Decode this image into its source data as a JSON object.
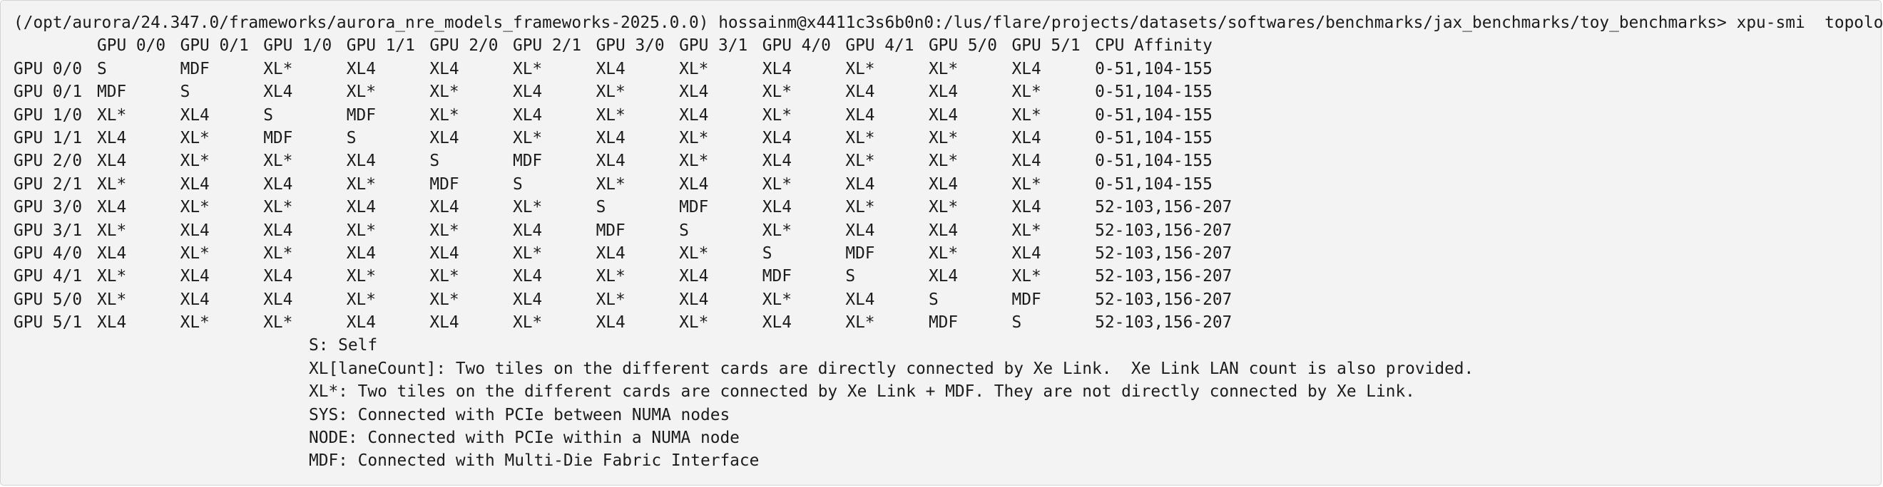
{
  "terminal": {
    "prompt": "(/opt/aurora/24.347.0/frameworks/aurora_nre_models_frameworks-2025.0.0) hossainm@x4411c3s6b0n0:/lus/flare/projects/datasets/softwares/benchmarks/jax_benchmarks/toy_benchmarks>",
    "command": "xpu-smi  topology -m"
  },
  "topology": {
    "headers": [
      "GPU 0/0",
      "GPU 0/1",
      "GPU 1/0",
      "GPU 1/1",
      "GPU 2/0",
      "GPU 2/1",
      "GPU 3/0",
      "GPU 3/1",
      "GPU 4/0",
      "GPU 4/1",
      "GPU 5/0",
      "GPU 5/1",
      "CPU Affinity"
    ],
    "rows": [
      {
        "label": "GPU 0/0",
        "cells": [
          "S",
          "MDF",
          "XL*",
          "XL4",
          "XL4",
          "XL*",
          "XL4",
          "XL*",
          "XL4",
          "XL*",
          "XL*",
          "XL4"
        ],
        "affinity": "0-51,104-155"
      },
      {
        "label": "GPU 0/1",
        "cells": [
          "MDF",
          "S",
          "XL4",
          "XL*",
          "XL*",
          "XL4",
          "XL*",
          "XL4",
          "XL*",
          "XL4",
          "XL4",
          "XL*"
        ],
        "affinity": "0-51,104-155"
      },
      {
        "label": "GPU 1/0",
        "cells": [
          "XL*",
          "XL4",
          "S",
          "MDF",
          "XL*",
          "XL4",
          "XL*",
          "XL4",
          "XL*",
          "XL4",
          "XL4",
          "XL*"
        ],
        "affinity": "0-51,104-155"
      },
      {
        "label": "GPU 1/1",
        "cells": [
          "XL4",
          "XL*",
          "MDF",
          "S",
          "XL4",
          "XL*",
          "XL4",
          "XL*",
          "XL4",
          "XL*",
          "XL*",
          "XL4"
        ],
        "affinity": "0-51,104-155"
      },
      {
        "label": "GPU 2/0",
        "cells": [
          "XL4",
          "XL*",
          "XL*",
          "XL4",
          "S",
          "MDF",
          "XL4",
          "XL*",
          "XL4",
          "XL*",
          "XL*",
          "XL4"
        ],
        "affinity": "0-51,104-155"
      },
      {
        "label": "GPU 2/1",
        "cells": [
          "XL*",
          "XL4",
          "XL4",
          "XL*",
          "MDF",
          "S",
          "XL*",
          "XL4",
          "XL*",
          "XL4",
          "XL4",
          "XL*"
        ],
        "affinity": "0-51,104-155"
      },
      {
        "label": "GPU 3/0",
        "cells": [
          "XL4",
          "XL*",
          "XL*",
          "XL4",
          "XL4",
          "XL*",
          "S",
          "MDF",
          "XL4",
          "XL*",
          "XL*",
          "XL4"
        ],
        "affinity": "52-103,156-207"
      },
      {
        "label": "GPU 3/1",
        "cells": [
          "XL*",
          "XL4",
          "XL4",
          "XL*",
          "XL*",
          "XL4",
          "MDF",
          "S",
          "XL*",
          "XL4",
          "XL4",
          "XL*"
        ],
        "affinity": "52-103,156-207"
      },
      {
        "label": "GPU 4/0",
        "cells": [
          "XL4",
          "XL*",
          "XL*",
          "XL4",
          "XL4",
          "XL*",
          "XL4",
          "XL*",
          "S",
          "MDF",
          "XL*",
          "XL4"
        ],
        "affinity": "52-103,156-207"
      },
      {
        "label": "GPU 4/1",
        "cells": [
          "XL*",
          "XL4",
          "XL4",
          "XL*",
          "XL*",
          "XL4",
          "XL*",
          "XL4",
          "MDF",
          "S",
          "XL4",
          "XL*"
        ],
        "affinity": "52-103,156-207"
      },
      {
        "label": "GPU 5/0",
        "cells": [
          "XL*",
          "XL4",
          "XL4",
          "XL*",
          "XL*",
          "XL4",
          "XL*",
          "XL4",
          "XL*",
          "XL4",
          "S",
          "MDF"
        ],
        "affinity": "52-103,156-207"
      },
      {
        "label": "GPU 5/1",
        "cells": [
          "XL4",
          "XL*",
          "XL*",
          "XL4",
          "XL4",
          "XL*",
          "XL4",
          "XL*",
          "XL4",
          "XL*",
          "MDF",
          "S"
        ],
        "affinity": "52-103,156-207"
      }
    ]
  },
  "legend": [
    "S: Self",
    "XL[laneCount]: Two tiles on the different cards are directly connected by Xe Link.  Xe Link LAN count is also provided.",
    "XL*: Two tiles on the different cards are connected by Xe Link + MDF. They are not directly connected by Xe Link.",
    "SYS: Connected with PCIe between NUMA nodes",
    "NODE: Connected with PCIe within a NUMA node",
    "MDF: Connected with Multi-Die Fabric Interface"
  ]
}
